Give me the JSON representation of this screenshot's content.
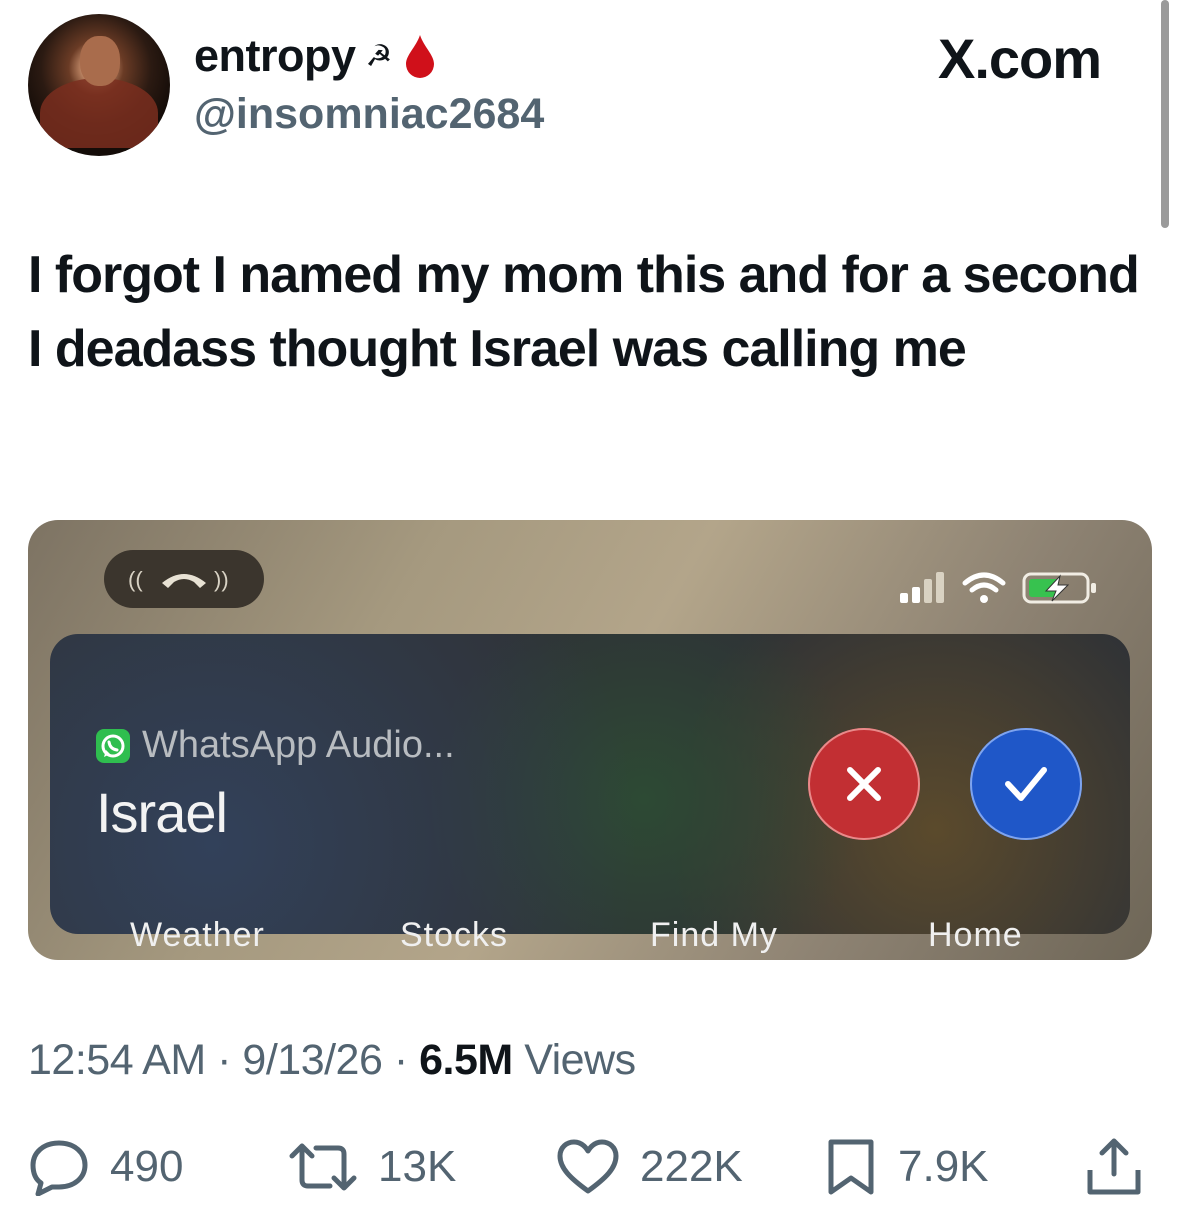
{
  "header": {
    "display_name": "entropy",
    "name_symbols": "☭",
    "handle": "@insomniac2684",
    "site": "X.com"
  },
  "tweet": {
    "text": "I forgot I named my mom this and for a second I deadass thought Israel was calling me"
  },
  "media": {
    "notification": {
      "app_label": "WhatsApp Audio...",
      "caller_name": "Israel"
    },
    "dock_labels": [
      "Weather",
      "Stocks",
      "Find My",
      "Home"
    ]
  },
  "meta": {
    "time": "12:54 AM",
    "date": "9/13/26",
    "views_count": "6.5M",
    "views_label": "Views",
    "separator": "·"
  },
  "actions": {
    "replies": "490",
    "reposts": "13K",
    "likes": "222K",
    "bookmarks": "7.9K"
  },
  "colors": {
    "text": "#0f1419",
    "secondary": "#536471",
    "decline": "#c22f33",
    "accept": "#1f57c8",
    "whatsapp": "#2fbe4f"
  },
  "icons": [
    "avatar-image",
    "hammer-sickle-icon",
    "blood-drop-icon",
    "phone-hangup-icon",
    "signal-icon",
    "wifi-icon",
    "battery-charging-icon",
    "whatsapp-icon",
    "close-icon",
    "check-icon",
    "reply-icon",
    "repost-icon",
    "like-icon",
    "bookmark-icon",
    "share-icon"
  ]
}
